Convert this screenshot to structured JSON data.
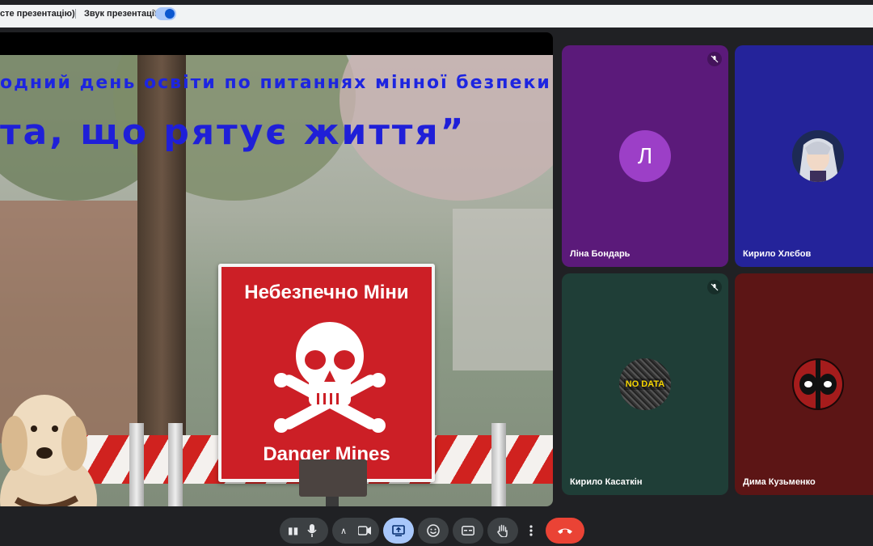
{
  "topbar": {
    "presentation_status": "сте презентацію)",
    "sound_label": "Звук презентації",
    "sound_enabled": true
  },
  "slide": {
    "title_line1": "одний день освіти по питаннях мінної безпеки",
    "title_line2": "та, що рятує життя”",
    "sign_ua": "Небезпечно Міни",
    "sign_en": "Danger Mines"
  },
  "participants": [
    {
      "name": "Ліна Бондарь",
      "avatar_letter": "Л",
      "muted": true,
      "bg": "#5b1a7a"
    },
    {
      "name": "Кирило Хлєбов",
      "avatar_letter": "",
      "muted": false,
      "bg": "#24239a"
    },
    {
      "name": "Кирило Касаткін",
      "avatar_letter": "",
      "avatar_text": "NO DATA",
      "muted": true,
      "bg": "#1f3e37"
    },
    {
      "name": "Дима Кузьменко",
      "avatar_letter": "",
      "muted": false,
      "bg": "#5c1515"
    }
  ],
  "presentation_controls": [
    "swap-icon",
    "fullscreen-icon",
    "share-icon"
  ],
  "toolbar": {
    "buttons": [
      "audio-level-icon",
      "microphone-icon",
      "chevron-up-icon",
      "camera-icon",
      "present-icon",
      "emoji-icon",
      "captions-icon",
      "raise-hand-icon",
      "more-icon",
      "end-call-icon"
    ]
  },
  "colors": {
    "end_call": "#ea4335",
    "active_button": "#a8c7fa",
    "slide_title": "#1d25e0"
  }
}
